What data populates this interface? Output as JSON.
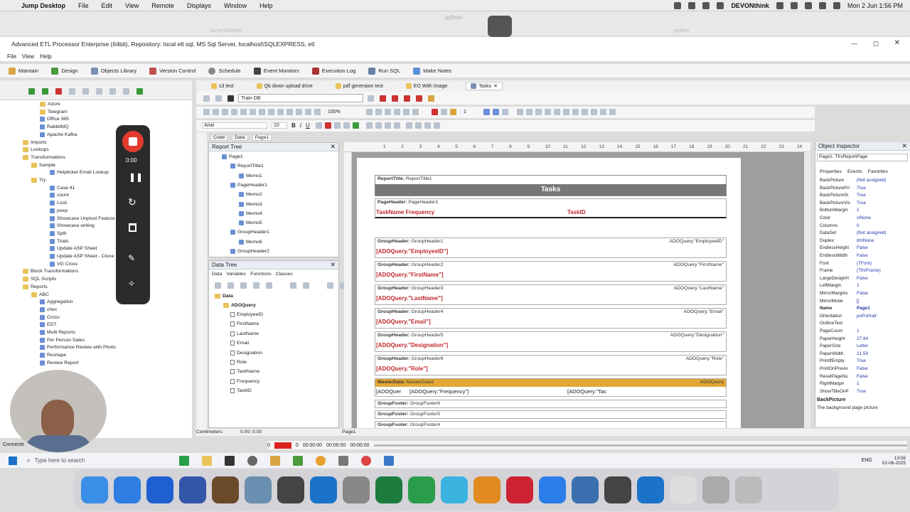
{
  "mac": {
    "app": "Jump Desktop",
    "menus": [
      "File",
      "Edit",
      "View",
      "Remote",
      "Displays",
      "Window",
      "Help"
    ],
    "status_app": "DEVONthink",
    "datetime": "Mon 2 Jun  1:56 PM"
  },
  "jump": {
    "window": "python",
    "title": "Jump Desktop",
    "right": "python"
  },
  "window": {
    "title": "Advanced ETL Processor Enterprise (64bit), Repository: local etl sql, MS Sql Server, localhost\\SQLEXPRESS, etl",
    "menus": [
      "File",
      "View",
      "Help"
    ]
  },
  "ribbon": {
    "tabs": [
      "Maintain",
      "Design",
      "Objects Library",
      "Version Control",
      "Schedule",
      "Event Monitors",
      "Execution Log",
      "Run SQL",
      "Make Notes"
    ]
  },
  "tree": {
    "items": [
      "Azure",
      "Telegram",
      "Office 365",
      "RabbitMQ",
      "Apache Kafka",
      "Imports",
      "Lookups",
      "Transformations",
      "Sample",
      "Helpticket Email Lookup",
      "Try",
      "Case 41",
      "count",
      "Lock",
      "poep",
      "Showcase Unpivot Feature",
      "Showcase writing",
      "Split",
      "Trials",
      "Update ASP Sheet",
      "Update ASP Sheet - Clone",
      "VG Cross",
      "Block Transformations",
      "SQL Scripts",
      "Reports",
      "ABC",
      "Aggregation",
      "chec",
      "Cross",
      "EDT",
      "Multi Reports",
      "Per Person Sales",
      "Performance Review with Photo",
      "Reshape",
      "Review Report"
    ],
    "connected": "Connecte"
  },
  "recorder": {
    "time": "0:00"
  },
  "doctabs": [
    "s3 test",
    "Qb down upload drive",
    "pdf generaion test",
    "EO With Image",
    "Tasks"
  ],
  "toolbar": {
    "db": "Train DB",
    "zoom": "100%",
    "font": "Arial",
    "size": "10",
    "linew": "1"
  },
  "designer": {
    "tabs": [
      "Code",
      "Data",
      "Page1"
    ]
  },
  "report_tree": {
    "title": "Report Tree",
    "items": [
      "Page1",
      "ReportTitle1",
      "Memo1",
      "PageHeader1",
      "Memo2",
      "Memo3",
      "Memo4",
      "Memo5",
      "GroupHeader1",
      "Memo6",
      "GroupHeader2"
    ]
  },
  "data_tree": {
    "title": "Data Tree",
    "tabs": [
      "Data",
      "Variables",
      "Functions",
      "Classes"
    ],
    "root": "Data",
    "query": "ADOQuery",
    "fields": [
      "EmployeeID",
      "FirstName",
      "LastName",
      "Email",
      "Designation",
      "Role",
      "TaskName",
      "Frequency",
      "TaskID"
    ]
  },
  "ruler": [
    "1",
    "2",
    "3",
    "4",
    "5",
    "6",
    "7",
    "8",
    "9",
    "10",
    "11",
    "12",
    "13",
    "14",
    "15",
    "16",
    "17",
    "18",
    "19",
    "20",
    "21",
    "22",
    "23",
    "24"
  ],
  "report": {
    "title_band": {
      "label": "ReportTitle:",
      "name": "ReportTitle1",
      "text": "Tasks"
    },
    "page_header": {
      "label": "PageHeader:",
      "name": "PageHeader1",
      "left": "TaskName Frequency",
      "right": "TaskID"
    },
    "groups": [
      {
        "label": "GroupHeader:",
        "name": "GroupHeader1",
        "field": "ADOQuery.\"EmployeeID\"",
        "expr": "[ADOQuery.\"EmployeeID\"]"
      },
      {
        "label": "GroupHeader:",
        "name": "GroupHeader2",
        "field": "ADOQuery.\"FirstName\"",
        "expr": "[ADOQuery.\"FirstName\"]"
      },
      {
        "label": "GroupHeader:",
        "name": "GroupHeader3",
        "field": "ADOQuery.\"LastName\"",
        "expr": "[ADOQuery.\"LastName\"]"
      },
      {
        "label": "GroupHeader:",
        "name": "GroupHeader4",
        "field": "ADOQuery.\"Email\"",
        "expr": "[ADOQuery.\"Email\"]"
      },
      {
        "label": "GroupHeader:",
        "name": "GroupHeader5",
        "field": "ADOQuery.\"Designation\"",
        "expr": "[ADOQuery.\"Designation\"]"
      },
      {
        "label": "GroupHeader:",
        "name": "GroupHeader6",
        "field": "ADOQuery.\"Role\"",
        "expr": "[ADOQuery.\"Role\"]"
      }
    ],
    "master": {
      "label": "MasterData:",
      "name": "MasterData1",
      "right": "ADOQuery",
      "c1": "[ADOQuer",
      "c2": "[ADOQuery.\"Frequency\"]",
      "c3": "[ADOQuery.\"Tas"
    },
    "footers": [
      {
        "label": "GroupFooter:",
        "name": "GroupFooter6"
      },
      {
        "label": "GroupFooter:",
        "name": "GroupFooter5"
      },
      {
        "label": "GroupFooter:",
        "name": "GroupFooter4"
      }
    ]
  },
  "inspector": {
    "title": "Object Inspector",
    "object": "Page1: TfrxReportPage",
    "tabs": [
      "Properties",
      "Events",
      "Favorites"
    ],
    "props": [
      [
        "BackPicture",
        "(Not assigned)"
      ],
      [
        "BackPicturePri",
        "True"
      ],
      [
        "BackPictureSt",
        "True"
      ],
      [
        "BackPictureVis",
        "True"
      ],
      [
        "BottomMargin",
        "1"
      ],
      [
        "Color",
        "clNone"
      ],
      [
        "Columns",
        "0"
      ],
      [
        "DataSet",
        "(Not assigned)"
      ],
      [
        "Duplex",
        "dmNone"
      ],
      [
        "EndlessHeight",
        "False"
      ],
      [
        "EndlessWidth",
        "False"
      ],
      [
        "Font",
        "(TFont)"
      ],
      [
        "Frame",
        "(TfrxFrame)"
      ],
      [
        "LargeDesignH",
        "False"
      ],
      [
        "LeftMargin",
        "1"
      ],
      [
        "MirrorMargins",
        "False"
      ],
      [
        "MirrorMode",
        "[]"
      ],
      [
        "Name",
        "Page1"
      ],
      [
        "Orientation",
        "poPortrait"
      ],
      [
        "OutlineText",
        ""
      ],
      [
        "PageCount",
        "1"
      ],
      [
        "PaperHeight",
        "27.94"
      ],
      [
        "PaperSize",
        "Letter"
      ],
      [
        "PaperWidth",
        "21.59"
      ],
      [
        "PrintIfEmpty",
        "True"
      ],
      [
        "PrintOnPrevio",
        "False"
      ],
      [
        "ResetPageNu",
        "False"
      ],
      [
        "RightMargin",
        "1"
      ],
      [
        "ShowTitleOnP",
        "True"
      ]
    ],
    "help_title": "BackPicture",
    "help_text": "The background page picture"
  },
  "status": {
    "units": "Centimeters",
    "coords": "0.00; 0.00",
    "page": "Page1"
  },
  "player": {
    "a": "0",
    "b": "00:00:00",
    "c": "00:00:00",
    "d": "00:00:00"
  },
  "win": {
    "search": "Type here to search",
    "lang": "ENG",
    "time": "13:56",
    "date": "02-06-2025"
  },
  "dock": [
    "Finder",
    "Safari",
    "Jump",
    "Bbedit",
    "Broom",
    "Preview",
    "Calc",
    "Outlook",
    "Tools",
    "Excel",
    "Code",
    "Sync",
    "Books",
    "Game",
    "Mail",
    "Network",
    "CSV",
    "Outlook2",
    "Doc",
    "Browser",
    "Trash"
  ]
}
